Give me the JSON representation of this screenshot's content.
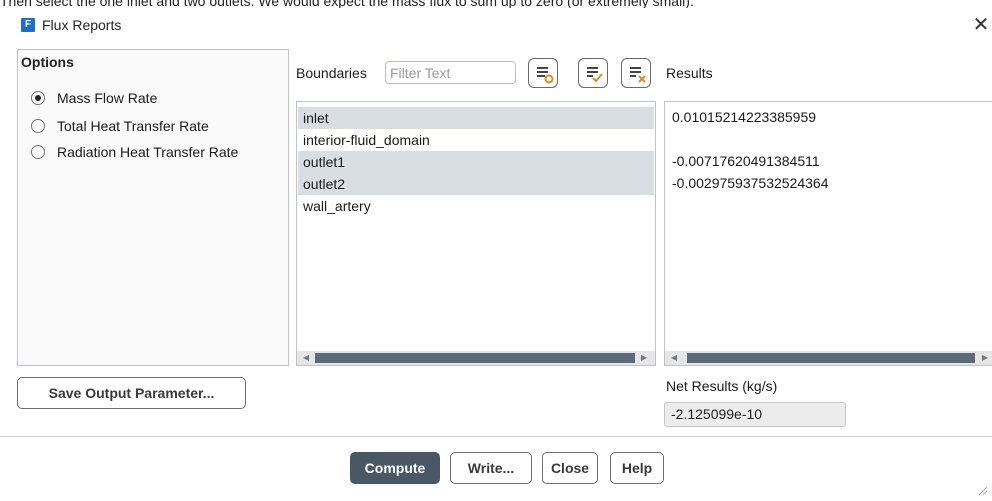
{
  "background": {
    "caption": "Then select the one inlet and two outlets. We would expect the mass flux to sum up to zero (or extremely small)."
  },
  "window": {
    "icon_letter": "F",
    "title": "Flux Reports",
    "close_icon": "close-icon"
  },
  "options": {
    "title": "Options",
    "items": [
      {
        "label": "Mass Flow Rate",
        "checked": true
      },
      {
        "label": "Total Heat Transfer Rate",
        "checked": false
      },
      {
        "label": "Radiation Heat Transfer Rate",
        "checked": false
      }
    ]
  },
  "boundaries": {
    "label": "Boundaries",
    "filter_placeholder": "Filter Text",
    "toolbar_icons": [
      "select-all-icon",
      "select-checked-icon",
      "deselect-all-icon"
    ],
    "items": [
      {
        "label": "inlet",
        "selected": true
      },
      {
        "label": "interior-fluid_domain",
        "selected": false
      },
      {
        "label": "outlet1",
        "selected": true
      },
      {
        "label": "outlet2",
        "selected": true
      },
      {
        "label": "wall_artery",
        "selected": false
      }
    ]
  },
  "results": {
    "label": "Results",
    "lines": [
      "0.01015214223385959",
      "",
      "-0.00717620491384511",
      "-0.002975937532524364"
    ],
    "net_label": "Net Results (kg/s)",
    "net_value": "-2.125099e-10"
  },
  "buttons": {
    "save_output": "Save Output Parameter...",
    "compute": "Compute",
    "write": "Write...",
    "close": "Close",
    "help": "Help"
  },
  "colors": {
    "primary_button": "#4a5866",
    "selection": "#d9dee5",
    "app_icon": "#1e6ec8"
  }
}
